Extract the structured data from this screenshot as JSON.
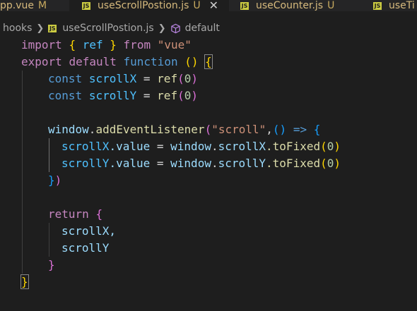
{
  "tabs": [
    {
      "name": "pp.vue",
      "status": "M"
    },
    {
      "name": "useScrollPostion.js",
      "status": "U",
      "active": true
    },
    {
      "name": "useCounter.js",
      "status": "U"
    },
    {
      "name": "useTi",
      "status": ""
    }
  ],
  "badge_text": "JS",
  "breadcrumb": {
    "folder": "hooks",
    "file": "useScrollPostion.js",
    "symbol": "default"
  },
  "code": {
    "l1": {
      "kw": "import",
      "open": "{",
      "name": "ref",
      "close": "}",
      "from": "from",
      "src": "\"vue\""
    },
    "l2": {
      "export": "export",
      "default": "default",
      "function": "function",
      "parens": "()",
      "brace": "{"
    },
    "l3": {
      "const": "const",
      "name": "scrollX",
      "eq": "=",
      "fn": "ref",
      "open": "(",
      "num": "0",
      "close": ")"
    },
    "l4": {
      "const": "const",
      "name": "scrollY",
      "eq": "=",
      "fn": "ref",
      "open": "(",
      "num": "0",
      "close": ")"
    },
    "l6": {
      "obj": "window",
      "dot": ".",
      "fn": "addEventListener",
      "open": "(",
      "str": "\"scroll\"",
      "comma": ",",
      "params": "()",
      "arrow": "=>",
      "brace": "{"
    },
    "l7": {
      "name": "scrollX",
      "prop": ".value",
      "eq": "=",
      "obj": "window",
      "dot": ".",
      "prop2": "scrollX",
      "fn": ".toFixed",
      "open": "(",
      "num": "0",
      "close": ")"
    },
    "l8": {
      "name": "scrollY",
      "prop": ".value",
      "eq": "=",
      "obj": "window",
      "dot": ".",
      "prop2": "scrollY",
      "fn": ".toFixed",
      "open": "(",
      "num": "0",
      "close": ")"
    },
    "l9": {
      "brace": "}",
      "paren": ")"
    },
    "l11": {
      "kw": "return",
      "brace": "{"
    },
    "l12": {
      "text": "scrollX,"
    },
    "l13": {
      "text": "scrollY"
    },
    "l14": {
      "brace": "}"
    },
    "l15": {
      "brace": "}"
    }
  },
  "colors": {
    "background": "#1e1e1e",
    "keyword_pink": "#c586c0",
    "keyword_blue": "#569cd6",
    "identifier": "#4fc1ff",
    "function": "#dcdcaa",
    "string": "#ce9178",
    "number": "#b5cea8"
  }
}
